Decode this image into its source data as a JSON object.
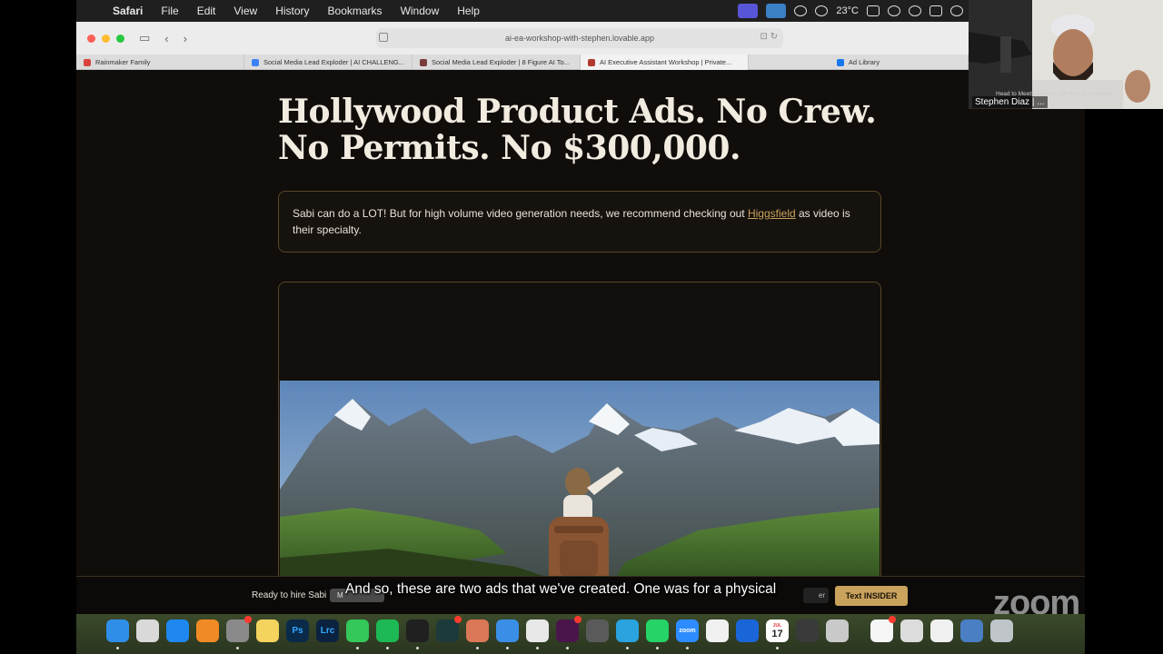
{
  "menubar": {
    "items": [
      "Safari",
      "File",
      "Edit",
      "View",
      "History",
      "Bookmarks",
      "Window",
      "Help"
    ],
    "temperature": "23°C"
  },
  "browser": {
    "url": "ai-ea-workshop-with-stephen.lovable.app",
    "tabs": [
      {
        "label": "Rainmaker Family",
        "color": "#d8443c"
      },
      {
        "label": "Social Media Lead Exploder | AI CHALLENG...",
        "color": "#3b82f6"
      },
      {
        "label": "Social Media Lead Exploder | 8 Figure AI To...",
        "color": "#7a3b3b"
      },
      {
        "label": "AI Executive Assistant Workshop | Private...",
        "color": "#b03a2e"
      },
      {
        "label": "Ad Library",
        "color": "#1877f2"
      }
    ]
  },
  "page": {
    "title": "Hollywood Product Ads. No Crew. No Permits. No $300,000.",
    "notice_before": "Sabi can do a LOT! But for high volume video generation needs, we recommend checking out ",
    "notice_link": "Higgsfield",
    "notice_after": " as video is their specialty.",
    "sticky_text": "Ready to hire Sabi",
    "sticky_pill": "M",
    "sticky_right": "er",
    "cta_label": "Text INSIDER"
  },
  "caption": "And so, these are two ads that we've created. One was for a physical",
  "webcam": {
    "name": "Stephen Diaz | ...",
    "banner": "Head to MeetSabi.com Get Your AI Assistant"
  },
  "zoom_logo": "zoom",
  "dock": {
    "calendar_day": "17",
    "calendar_month": "JUL",
    "apps": [
      {
        "name": "finder",
        "color": "#2f8fe8"
      },
      {
        "name": "launchpad",
        "color": "#d9d9d9"
      },
      {
        "name": "app-store",
        "color": "#1e88f0"
      },
      {
        "name": "books",
        "color": "#f08a24"
      },
      {
        "name": "system-settings",
        "color": "#8a8a8a"
      },
      {
        "name": "notes",
        "color": "#f4d35e"
      },
      {
        "name": "photoshop",
        "color": "#0a2a4a",
        "label": "Ps"
      },
      {
        "name": "lightroom",
        "color": "#0b2340",
        "label": "Lrc"
      },
      {
        "name": "messages",
        "color": "#34c759"
      },
      {
        "name": "spotify",
        "color": "#1db954"
      },
      {
        "name": "chatgpt",
        "color": "#202020"
      },
      {
        "name": "perplexity",
        "color": "#1d3a3a"
      },
      {
        "name": "claude",
        "color": "#d97757"
      },
      {
        "name": "safari",
        "color": "#3a8ee6"
      },
      {
        "name": "chrome",
        "color": "#e8e8e8"
      },
      {
        "name": "slack",
        "color": "#4a154b"
      },
      {
        "name": "tool",
        "color": "#5a5a5a"
      },
      {
        "name": "telegram",
        "color": "#2aa3df"
      },
      {
        "name": "whatsapp",
        "color": "#25d366"
      },
      {
        "name": "zoom",
        "color": "#2d8cff",
        "label": "zoom"
      },
      {
        "name": "drive",
        "color": "#f0f0f0"
      },
      {
        "name": "1password",
        "color": "#1a66d8"
      },
      {
        "name": "calendar",
        "color": "#ffffff"
      },
      {
        "name": "calculator",
        "color": "#3a3a3a"
      },
      {
        "name": "preview",
        "color": "#c9c9c9"
      },
      {
        "name": "reminders",
        "color": "#f5f5f5"
      },
      {
        "name": "screenshot",
        "color": "#dcdcdc"
      },
      {
        "name": "textedit",
        "color": "#f0f0f0"
      },
      {
        "name": "downloads",
        "color": "#4a7fc4"
      },
      {
        "name": "trash",
        "color": "#bfc5c9"
      }
    ]
  }
}
